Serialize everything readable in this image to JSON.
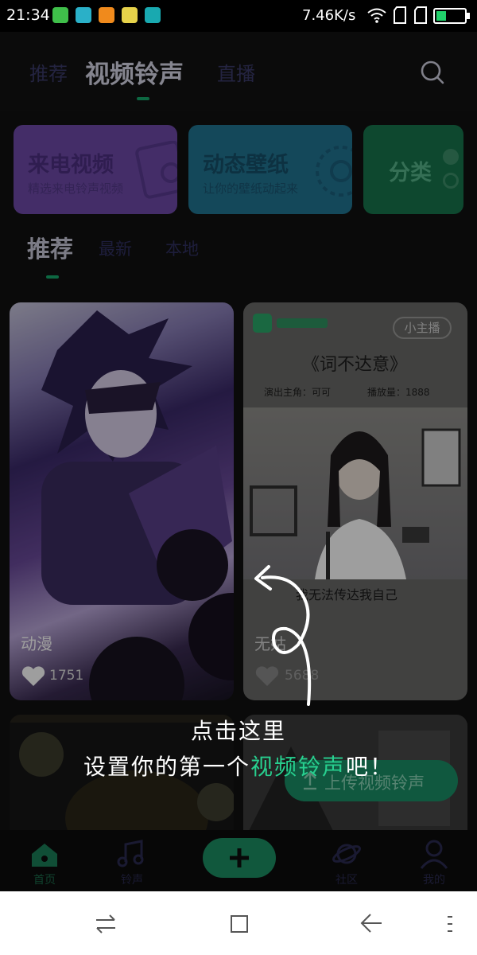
{
  "status_bar": {
    "time": "21:34",
    "net_speed": "7.46K/s",
    "battery_color": "#21d16b"
  },
  "header": {
    "tabs": [
      "推荐",
      "视频铃声",
      "直播"
    ],
    "active_tab": "视频铃声"
  },
  "categories": [
    {
      "title": "来电视频",
      "subtitle": "精选来电铃声视频",
      "color": "#8b62c9"
    },
    {
      "title": "动态壁纸",
      "subtitle": "让你的壁纸动起来",
      "color": "#2a8fb2"
    },
    {
      "title": "分类",
      "subtitle": "",
      "color": "#1f9a63"
    }
  ],
  "sub_tabs": [
    "推荐",
    "最新",
    "本地"
  ],
  "videos": [
    {
      "label": "动漫",
      "likes": "1751"
    },
    {
      "label": "无姑",
      "likes": "5688",
      "badge": "小主播",
      "poster_title": "《词不达意》",
      "poster_meta_left": "演出主角：可可",
      "poster_meta_right": "播放量：1888",
      "subtitle": "我无法传达我自己"
    }
  ],
  "upload_button": "上传视频铃声",
  "hint": {
    "line1": "点击这里",
    "line2_prefix": "设置你的第一个",
    "line2_highlight": "视频铃声",
    "line2_suffix": "吧！"
  },
  "bottom_nav": [
    "首页",
    "铃声",
    "社区",
    "我的"
  ],
  "accent_color": "#1fc98a"
}
